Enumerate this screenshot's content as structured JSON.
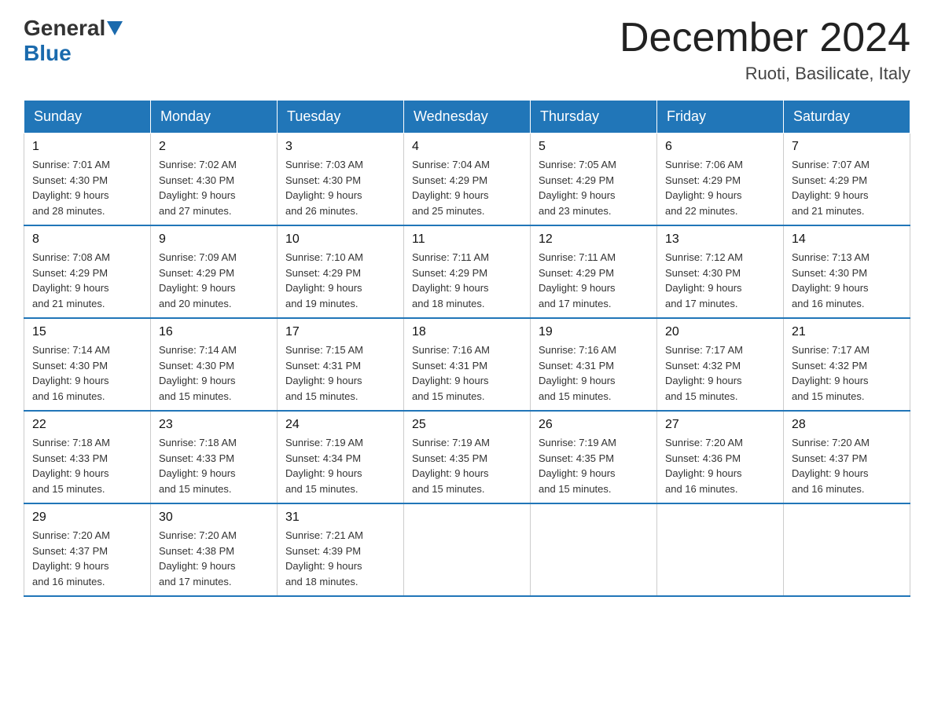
{
  "header": {
    "logo_general": "General",
    "logo_blue": "Blue",
    "month_title": "December 2024",
    "location": "Ruoti, Basilicate, Italy"
  },
  "days_of_week": [
    "Sunday",
    "Monday",
    "Tuesday",
    "Wednesday",
    "Thursday",
    "Friday",
    "Saturday"
  ],
  "weeks": [
    [
      {
        "day": "1",
        "sunrise": "7:01 AM",
        "sunset": "4:30 PM",
        "daylight": "9 hours and 28 minutes."
      },
      {
        "day": "2",
        "sunrise": "7:02 AM",
        "sunset": "4:30 PM",
        "daylight": "9 hours and 27 minutes."
      },
      {
        "day": "3",
        "sunrise": "7:03 AM",
        "sunset": "4:30 PM",
        "daylight": "9 hours and 26 minutes."
      },
      {
        "day": "4",
        "sunrise": "7:04 AM",
        "sunset": "4:29 PM",
        "daylight": "9 hours and 25 minutes."
      },
      {
        "day": "5",
        "sunrise": "7:05 AM",
        "sunset": "4:29 PM",
        "daylight": "9 hours and 23 minutes."
      },
      {
        "day": "6",
        "sunrise": "7:06 AM",
        "sunset": "4:29 PM",
        "daylight": "9 hours and 22 minutes."
      },
      {
        "day": "7",
        "sunrise": "7:07 AM",
        "sunset": "4:29 PM",
        "daylight": "9 hours and 21 minutes."
      }
    ],
    [
      {
        "day": "8",
        "sunrise": "7:08 AM",
        "sunset": "4:29 PM",
        "daylight": "9 hours and 21 minutes."
      },
      {
        "day": "9",
        "sunrise": "7:09 AM",
        "sunset": "4:29 PM",
        "daylight": "9 hours and 20 minutes."
      },
      {
        "day": "10",
        "sunrise": "7:10 AM",
        "sunset": "4:29 PM",
        "daylight": "9 hours and 19 minutes."
      },
      {
        "day": "11",
        "sunrise": "7:11 AM",
        "sunset": "4:29 PM",
        "daylight": "9 hours and 18 minutes."
      },
      {
        "day": "12",
        "sunrise": "7:11 AM",
        "sunset": "4:29 PM",
        "daylight": "9 hours and 17 minutes."
      },
      {
        "day": "13",
        "sunrise": "7:12 AM",
        "sunset": "4:30 PM",
        "daylight": "9 hours and 17 minutes."
      },
      {
        "day": "14",
        "sunrise": "7:13 AM",
        "sunset": "4:30 PM",
        "daylight": "9 hours and 16 minutes."
      }
    ],
    [
      {
        "day": "15",
        "sunrise": "7:14 AM",
        "sunset": "4:30 PM",
        "daylight": "9 hours and 16 minutes."
      },
      {
        "day": "16",
        "sunrise": "7:14 AM",
        "sunset": "4:30 PM",
        "daylight": "9 hours and 15 minutes."
      },
      {
        "day": "17",
        "sunrise": "7:15 AM",
        "sunset": "4:31 PM",
        "daylight": "9 hours and 15 minutes."
      },
      {
        "day": "18",
        "sunrise": "7:16 AM",
        "sunset": "4:31 PM",
        "daylight": "9 hours and 15 minutes."
      },
      {
        "day": "19",
        "sunrise": "7:16 AM",
        "sunset": "4:31 PM",
        "daylight": "9 hours and 15 minutes."
      },
      {
        "day": "20",
        "sunrise": "7:17 AM",
        "sunset": "4:32 PM",
        "daylight": "9 hours and 15 minutes."
      },
      {
        "day": "21",
        "sunrise": "7:17 AM",
        "sunset": "4:32 PM",
        "daylight": "9 hours and 15 minutes."
      }
    ],
    [
      {
        "day": "22",
        "sunrise": "7:18 AM",
        "sunset": "4:33 PM",
        "daylight": "9 hours and 15 minutes."
      },
      {
        "day": "23",
        "sunrise": "7:18 AM",
        "sunset": "4:33 PM",
        "daylight": "9 hours and 15 minutes."
      },
      {
        "day": "24",
        "sunrise": "7:19 AM",
        "sunset": "4:34 PM",
        "daylight": "9 hours and 15 minutes."
      },
      {
        "day": "25",
        "sunrise": "7:19 AM",
        "sunset": "4:35 PM",
        "daylight": "9 hours and 15 minutes."
      },
      {
        "day": "26",
        "sunrise": "7:19 AM",
        "sunset": "4:35 PM",
        "daylight": "9 hours and 15 minutes."
      },
      {
        "day": "27",
        "sunrise": "7:20 AM",
        "sunset": "4:36 PM",
        "daylight": "9 hours and 16 minutes."
      },
      {
        "day": "28",
        "sunrise": "7:20 AM",
        "sunset": "4:37 PM",
        "daylight": "9 hours and 16 minutes."
      }
    ],
    [
      {
        "day": "29",
        "sunrise": "7:20 AM",
        "sunset": "4:37 PM",
        "daylight": "9 hours and 16 minutes."
      },
      {
        "day": "30",
        "sunrise": "7:20 AM",
        "sunset": "4:38 PM",
        "daylight": "9 hours and 17 minutes."
      },
      {
        "day": "31",
        "sunrise": "7:21 AM",
        "sunset": "4:39 PM",
        "daylight": "9 hours and 18 minutes."
      },
      null,
      null,
      null,
      null
    ]
  ],
  "labels": {
    "sunrise": "Sunrise:",
    "sunset": "Sunset:",
    "daylight": "Daylight:"
  }
}
